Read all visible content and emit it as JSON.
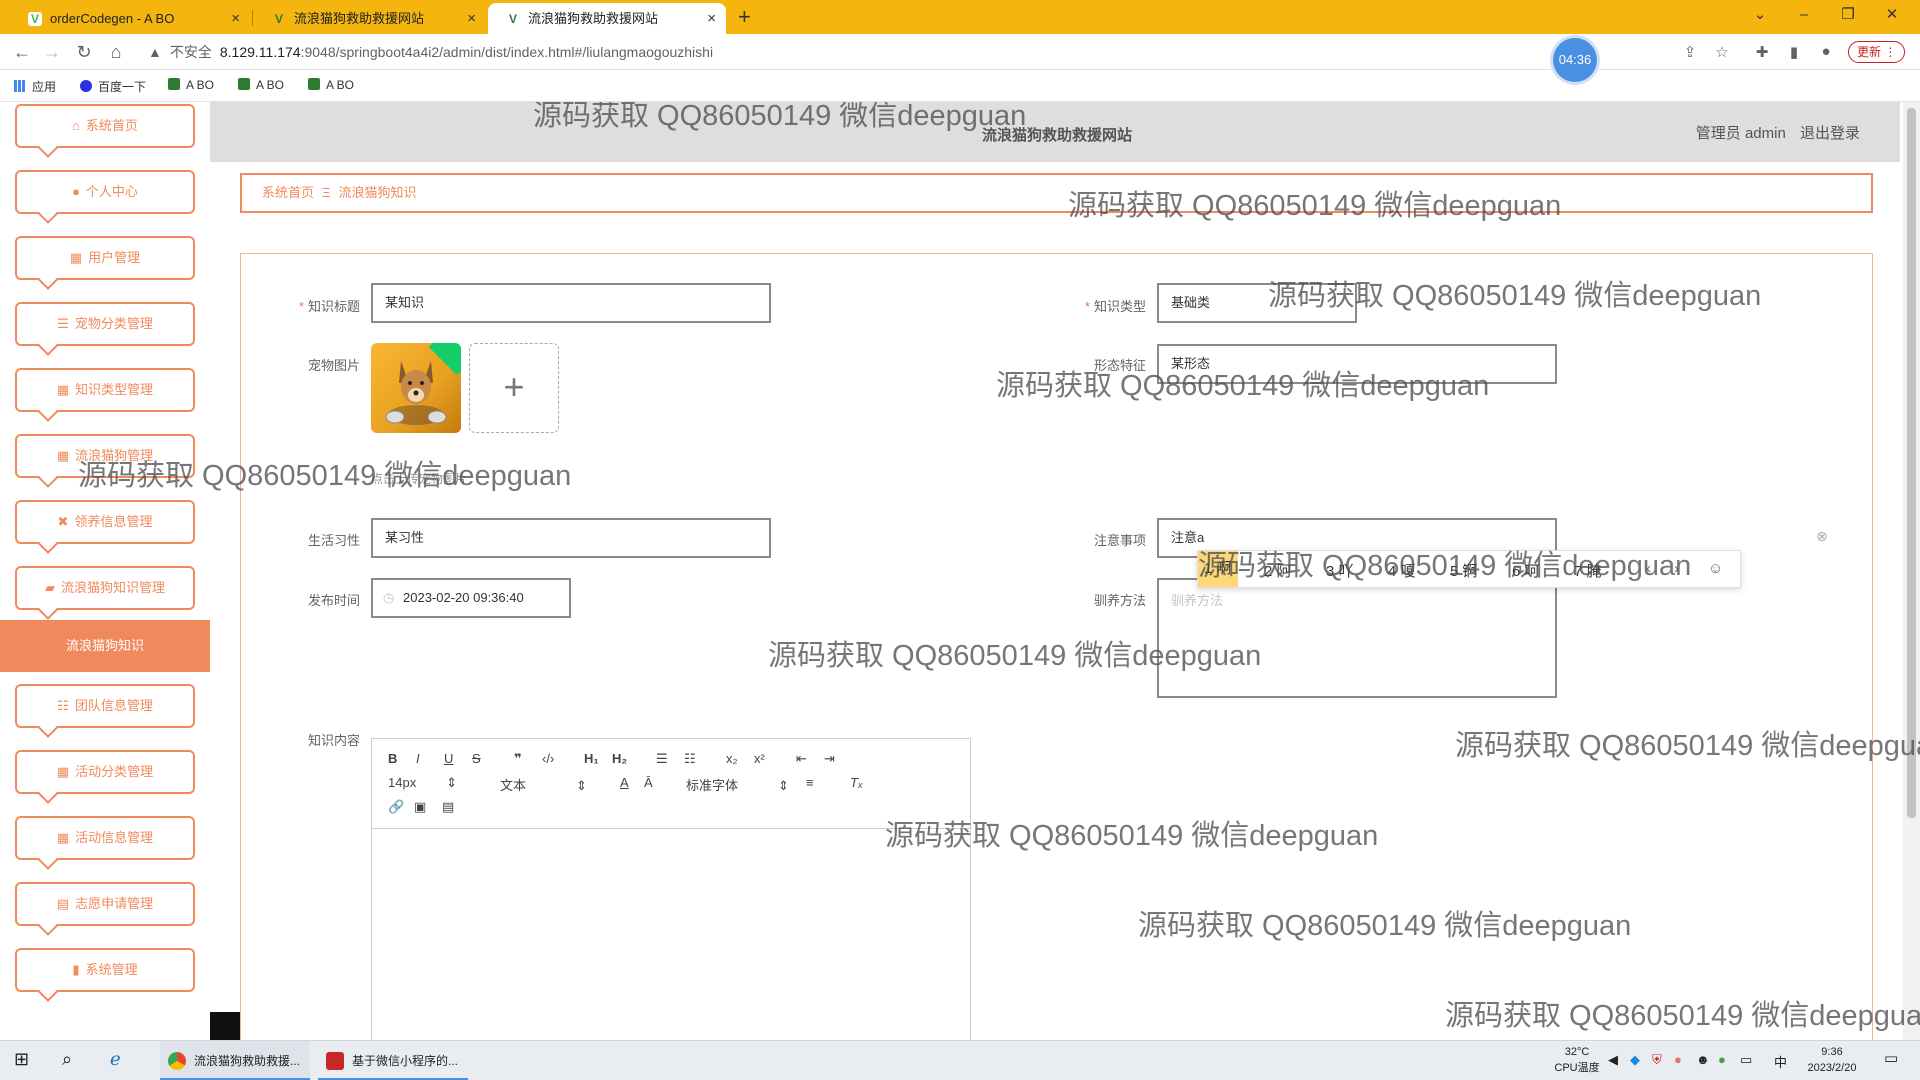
{
  "browser": {
    "tabs": [
      {
        "title": "orderCodegen - A BO",
        "active": false
      },
      {
        "title": "流浪猫狗救助救援网站",
        "active": false
      },
      {
        "title": "流浪猫狗救助救援网站",
        "active": true
      }
    ],
    "address": {
      "security_label": "不安全",
      "url_host": "8.129.11.174",
      "url_path": ":9048/springboot4a4i2/admin/dist/index.html#/liulangmaogouzhishi"
    },
    "timer_badge": "04:36",
    "update_label": "更新",
    "bookmarks": [
      "应用",
      "百度一下",
      "A BO",
      "A BO",
      "A BO"
    ]
  },
  "header": {
    "site_title": "流浪猫狗救助救援网站",
    "admin_label": "管理员 admin",
    "logout_label": "退出登录"
  },
  "sidebar": {
    "items": [
      {
        "label": "系统首页",
        "icon": "home-icon"
      },
      {
        "label": "个人中心",
        "icon": "user-icon"
      },
      {
        "label": "用户管理",
        "icon": "grid-icon"
      },
      {
        "label": "宠物分类管理",
        "icon": "list-icon"
      },
      {
        "label": "知识类型管理",
        "icon": "grid-icon"
      },
      {
        "label": "流浪猫狗管理",
        "icon": "grid-icon"
      },
      {
        "label": "领养信息管理",
        "icon": "ticket-icon"
      },
      {
        "label": "流浪猫狗知识管理",
        "icon": "folder-icon"
      }
    ],
    "active_item": "流浪猫狗知识",
    "items_after": [
      {
        "label": "团队信息管理",
        "icon": "sliders-icon"
      },
      {
        "label": "活动分类管理",
        "icon": "grid-icon"
      },
      {
        "label": "活动信息管理",
        "icon": "grid-icon"
      },
      {
        "label": "志愿申请管理",
        "icon": "clipboard-icon"
      },
      {
        "label": "系统管理",
        "icon": "chart-icon"
      }
    ]
  },
  "breadcrumb": {
    "home": "系统首页",
    "separator": "Ξ",
    "current": "流浪猫狗知识"
  },
  "form": {
    "title_label": "知识标题",
    "title_value": "某知识",
    "type_label": "知识类型",
    "type_value": "基础类",
    "image_label": "宠物图片",
    "image_tip": "点击上传宠物图片",
    "feature_label": "形态特征",
    "feature_value": "某形态",
    "habit_label": "生活习性",
    "habit_value": "某习性",
    "notes_label": "注意事项",
    "notes_value": "注意a",
    "date_label": "发布时间",
    "date_value": "2023-02-20 09:36:40",
    "training_label": "驯养方法",
    "training_placeholder": "驯养方法",
    "content_label": "知识内容"
  },
  "ime": {
    "candidates": [
      "1 啊",
      "2 阿",
      "3 吖",
      "4 嗄",
      "5 锕",
      "6 呵",
      "7 腌"
    ]
  },
  "editor": {
    "font_size": "14px",
    "block_format": "文本",
    "font_family": "标准字体"
  },
  "watermark_text": "源码获取 QQ86050149 微信deepguan",
  "taskbar": {
    "apps": [
      "流浪猫狗救助救援...",
      "基于微信小程序的..."
    ],
    "temperature": "32°C",
    "temperature_label": "CPU温度",
    "time": "9:36",
    "date": "2023/2/20",
    "ime_lang": "中"
  }
}
